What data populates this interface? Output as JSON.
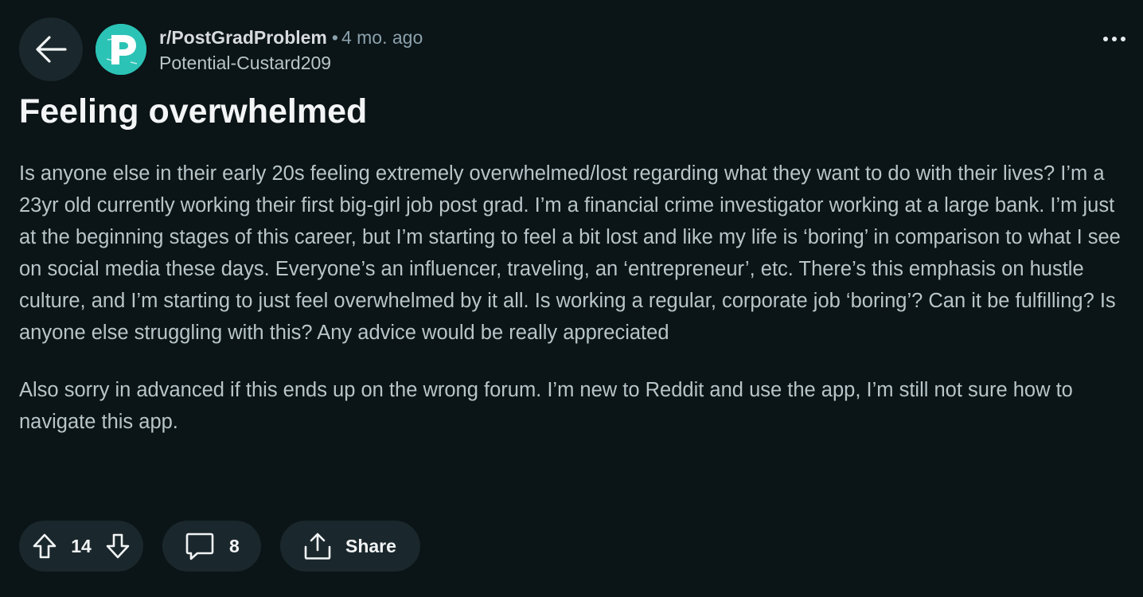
{
  "header": {
    "subreddit": "r/PostGradProblem",
    "separator": "•",
    "age": "4 mo. ago",
    "author": "Potential-Custard209",
    "avatar_letter": "P",
    "avatar_color": "#2bc3b5"
  },
  "post": {
    "title": "Feeling overwhelmed",
    "paragraphs": [
      "Is anyone else in their early 20s feeling extremely overwhelmed/lost regarding what they want to do with their lives? I’m a 23yr old currently working their first big-girl job post grad. I’m a financial crime investigator working at a large bank. I’m just at the beginning stages of this career, but I’m starting to feel a bit lost and like my life is ‘boring’ in comparison to what I see on social media these days. Everyone’s an influencer, traveling, an ‘entrepreneur’, etc. There’s this emphasis on hustle culture, and I’m starting to just feel overwhelmed by it all. Is working a regular, corporate job ‘boring’? Can it be fulfilling? Is anyone else struggling with this? Any advice would be really appreciated",
      "Also sorry in advanced if this ends up on the wrong forum. I’m new to Reddit and use the app, I’m still not sure how to navigate this app."
    ]
  },
  "actions": {
    "score": "14",
    "comments": "8",
    "share_label": "Share"
  },
  "icons": {
    "back": "arrow-left-icon",
    "more": "ellipsis-icon",
    "upvote": "arrow-up-icon",
    "downvote": "arrow-down-icon",
    "comment": "speech-bubble-icon",
    "share": "share-icon"
  },
  "colors": {
    "background": "#0b1416",
    "pill": "#1a282d",
    "body_text": "#b8c5c9"
  }
}
